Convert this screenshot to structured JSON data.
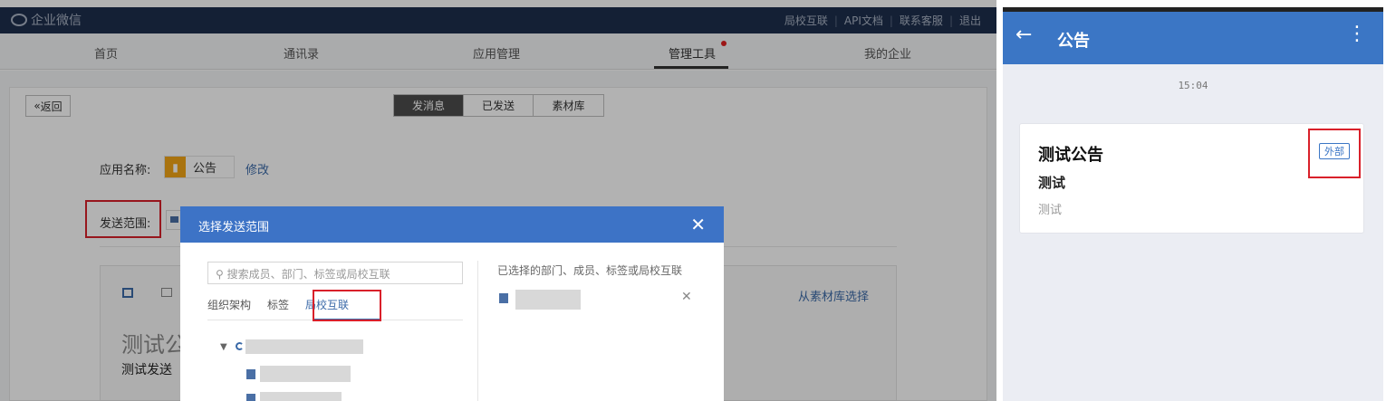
{
  "desktop": {
    "brand": "企业微信",
    "top_links": [
      "局校互联",
      "API文档",
      "联系客服",
      "退出"
    ],
    "nav": [
      "首页",
      "通讯录",
      "应用管理",
      "管理工具",
      "我的企业"
    ],
    "back_label": "返回",
    "segments": [
      "发消息",
      "已发送",
      "素材库"
    ],
    "app_name_label": "应用名称:",
    "app_name": "公告",
    "modify_label": "修改",
    "send_range_label": "发送范围:",
    "from_library": "从素材库选择",
    "editor_title": "测试公",
    "editor_subtitle": "测试发送"
  },
  "modal": {
    "title": "选择发送范围",
    "search_placeholder": "搜索成员、部门、标签或局校互联",
    "tabs": [
      "组织架构",
      "标签",
      "局校互联"
    ],
    "selected_label": "已选择的部门、成员、标签或局校互联",
    "tree_expand": "▼"
  },
  "mobile": {
    "title": "公告",
    "time": "15:04",
    "card_title": "测试公告",
    "card_subtitle": "测试",
    "card_body": "测试",
    "badge": "外部"
  },
  "colors": {
    "accent": "#3b76c5",
    "highlight_red": "#d9202a",
    "topbar": "#1e2f4c",
    "app_icon": "#f2a516"
  }
}
